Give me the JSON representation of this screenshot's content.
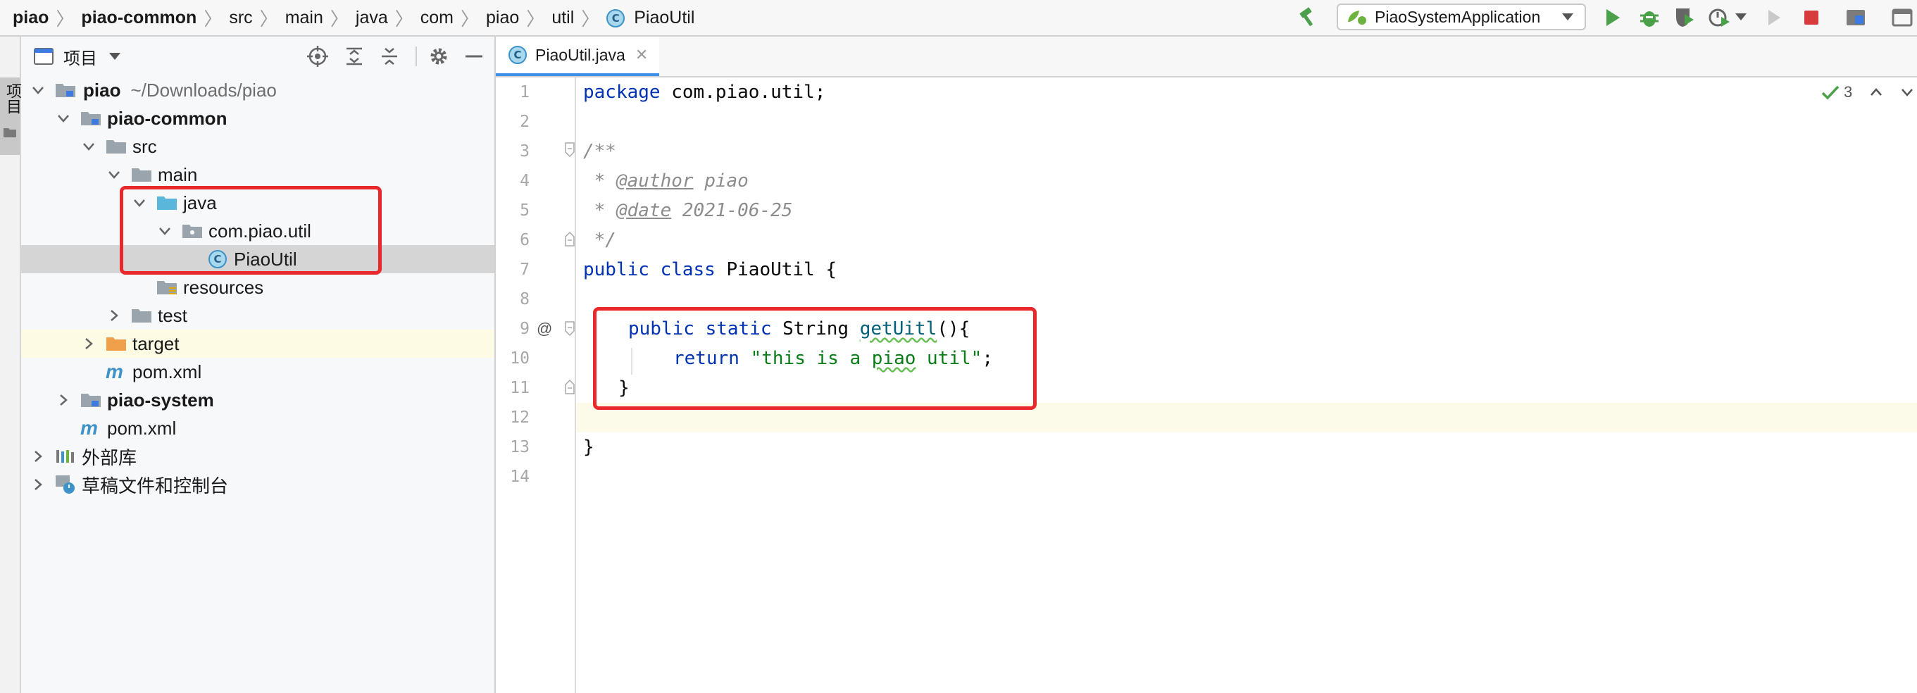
{
  "breadcrumb": {
    "items": [
      "piao",
      "piao-common",
      "src",
      "main",
      "java",
      "com",
      "piao",
      "util"
    ],
    "file": "PiaoUtil",
    "file_icon_letter": "C"
  },
  "toolbar": {
    "run_config": "PiaoSystemApplication",
    "icons": [
      "build-hammer-icon",
      "run-icon",
      "debug-icon",
      "coverage-icon",
      "profile-icon",
      "stop-icon",
      "project-structure-icon"
    ]
  },
  "left_stripe": {
    "tab_label": "项目"
  },
  "project_panel": {
    "title": "项目",
    "tree": [
      {
        "label": "piao",
        "path": "~/Downloads/piao"
      },
      {
        "label": "piao-common"
      },
      {
        "label": "src"
      },
      {
        "label": "main"
      },
      {
        "label": "java"
      },
      {
        "label": "com.piao.util"
      },
      {
        "label": "PiaoUtil",
        "icon_letter": "C"
      },
      {
        "label": "resources"
      },
      {
        "label": "test"
      },
      {
        "label": "target"
      },
      {
        "label": "pom.xml",
        "icon_letter": "m"
      },
      {
        "label": "piao-system"
      },
      {
        "label": "pom.xml",
        "icon_letter": "m"
      },
      {
        "label": "外部库"
      },
      {
        "label": "草稿文件和控制台"
      }
    ]
  },
  "editor": {
    "tab_label": "PiaoUtil.java",
    "tab_icon_letter": "C",
    "inspection_count": "3",
    "gutter_marker": "@",
    "line_numbers": [
      "1",
      "2",
      "3",
      "4",
      "5",
      "6",
      "7",
      "8",
      "9",
      "10",
      "11",
      "12",
      "13",
      "14"
    ],
    "code": {
      "l1_kw": "package",
      "l1_rest": " com.piao.util;",
      "l3": "/**",
      "l4_star": " * ",
      "l4_tag": "@author",
      "l4_val": " piao",
      "l5_star": " * ",
      "l5_tag": "@date",
      "l5_val": " 2021-06-25",
      "l6": " */",
      "l7_kw": "public class",
      "l7_rest": " PiaoUtil {",
      "l9_kw": "public static",
      "l9_type": " String ",
      "l9_name": "getUitl",
      "l9_rest": "(){",
      "l10_kw": "return ",
      "l10_str1": "\"this is a ",
      "l10_sq1": "piao",
      "l10_str2": " util\"",
      "l10_end": ";",
      "l11": "}",
      "l13": "}"
    }
  },
  "colors": {
    "annotation_box": "#e8282a",
    "keyword": "#0033b3",
    "string": "#067d17",
    "method": "#00627a",
    "comment": "#8c8c8c",
    "selection": "#d5d5d5",
    "caret_line": "#fcfae8"
  }
}
